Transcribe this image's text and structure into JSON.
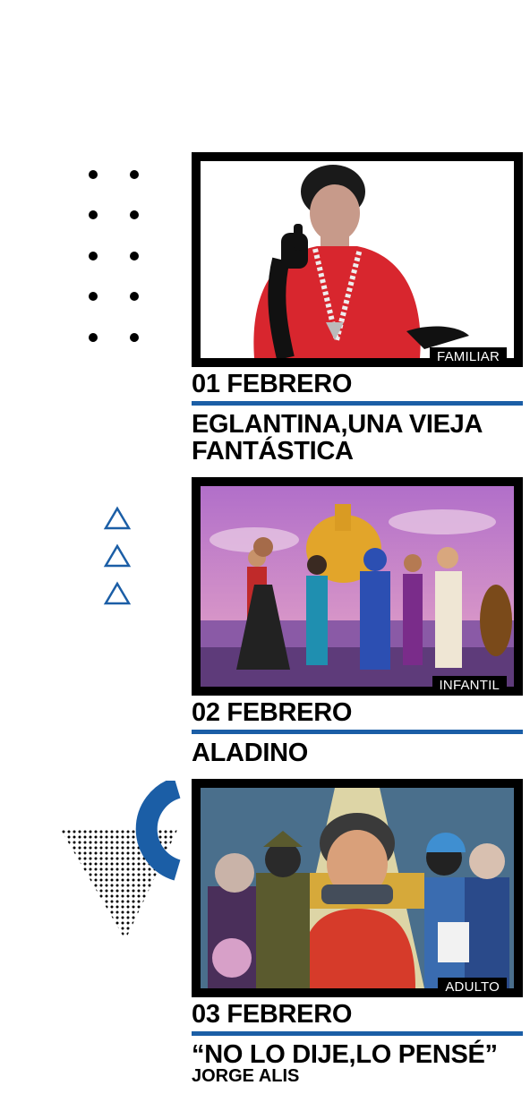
{
  "events": [
    {
      "category": "FAMILIAR",
      "date": "01 FEBRERO",
      "title": "EGLANTINA,UNA VIEJA FANTÁSTICA",
      "image_desc": "performer-in-red-dress"
    },
    {
      "category": "INFANTIL",
      "date": "02 FEBRERO",
      "title": "ALADINO",
      "image_desc": "aladdin-cast-on-stage"
    },
    {
      "category": "ADULTO",
      "date": "03 FEBRERO",
      "title": "“NO LO DIJE,LO PENSÉ”",
      "subtitle": "JORGE ALIS",
      "image_desc": "comedian-caricature-poster"
    }
  ],
  "colors": {
    "accent": "#1b5ea6",
    "frame": "#000000",
    "text": "#000000",
    "background": "#ffffff"
  }
}
